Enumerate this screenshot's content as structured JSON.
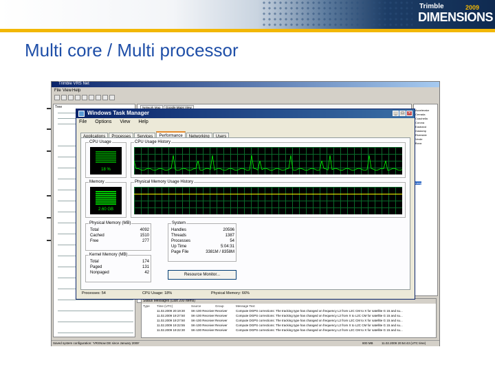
{
  "slide": {
    "title": "Multi core / Multi processor",
    "brand": {
      "small": "Trimble",
      "year": "2009",
      "big": "DIMENSIONS"
    },
    "colors": {
      "title": "#1f4fa8",
      "accent": "#f2b705",
      "banner_dark": "#0f2a50"
    }
  },
  "app": {
    "title": "Trimble VRS Net",
    "menu": [
      "File",
      "View",
      "Help"
    ],
    "tree_header": "Tree",
    "map_tabs": [
      "Network Map",
      "Google Maps View"
    ],
    "right_list": [
      "Accelerator",
      "Cerrada",
      "Coachella",
      "Corona",
      "Eastrand",
      "Gaslamp",
      "Riverside",
      "Verde",
      "Boca",
      "Lang"
    ],
    "status_messages": {
      "header": "Status Messages (Last 200 Items)",
      "columns": [
        "Type",
        "Time (UTC)",
        "Source",
        "Group",
        "Message Text"
      ],
      "rows": [
        [
          "",
          "11.02.2009 20:19:30",
          "SK-100 Receiver",
          "Receiver",
          "Compute DGPS corrections: The tracking type has changed on frequency L2 from L2C CM to X for satellite G 15 and su..."
        ],
        [
          "",
          "11.02.2009 19:27:50",
          "SK-100 Receiver",
          "Receiver",
          "Compute DGPS corrections: The tracking type has changed on frequency L2 from X to L2C CM for satellite G 15 and su..."
        ],
        [
          "",
          "11.02.2009 19:27:50",
          "SK-100 Receiver",
          "Receiver",
          "Compute DGPS corrections: The tracking type has changed on frequency L2 from L2C CM to X for satellite G 15 and su..."
        ],
        [
          "",
          "11.02.2009 19:22:55",
          "SK-100 Receiver",
          "Receiver",
          "Compute DGPS corrections: The tracking type has changed on frequency L2 from X to L2C CM for satellite G 15 and su..."
        ],
        [
          "",
          "11.02.2009 19:22:30",
          "SK-100 Receiver",
          "Receiver",
          "Compute DGPS corrections: The tracking type has changed on frequency L2 from L2C CM to X for satellite G 15 and su..."
        ]
      ]
    },
    "statusbar": "Saved system configuration: 'VRSNow DE since January 2009'",
    "statusbar_right": "11.02.2009 20:54:43 (UTC time)",
    "statusbar_mem": "800 MB"
  },
  "task_manager": {
    "title": "Windows Task Manager",
    "menu": [
      "File",
      "Options",
      "View",
      "Help"
    ],
    "tabs": [
      "Applications",
      "Processes",
      "Services",
      "Performance",
      "Networking",
      "Users"
    ],
    "selected_tab": "Performance",
    "cpu_usage_label": "CPU Usage",
    "cpu_usage_value": "18 %",
    "cpu_history_label": "CPU Usage History",
    "memory_label": "Memory",
    "memory_value": "2.60 GB",
    "mem_history_label": "Physical Memory Usage History",
    "physical_memory": {
      "label": "Physical Memory (MB)",
      "rows": [
        [
          "Total",
          "4092"
        ],
        [
          "Cached",
          "1510"
        ],
        [
          "Free",
          "277"
        ]
      ]
    },
    "kernel_memory": {
      "label": "Kernel Memory (MB)",
      "rows": [
        [
          "Total",
          "174"
        ],
        [
          "Paged",
          "131"
        ],
        [
          "Nonpaged",
          "42"
        ]
      ]
    },
    "system": {
      "label": "System",
      "rows": [
        [
          "Handles",
          "20596"
        ],
        [
          "Threads",
          "1387"
        ],
        [
          "Processes",
          "54"
        ],
        [
          "Up Time",
          "5:04:31"
        ],
        [
          "Page File",
          "3381M / 8358M"
        ]
      ]
    },
    "resource_monitor_button": "Resource Monitor...",
    "status": {
      "processes": "Processes: 54",
      "cpu": "CPU Usage: 18%",
      "memory": "Physical Memory: 66%"
    }
  }
}
